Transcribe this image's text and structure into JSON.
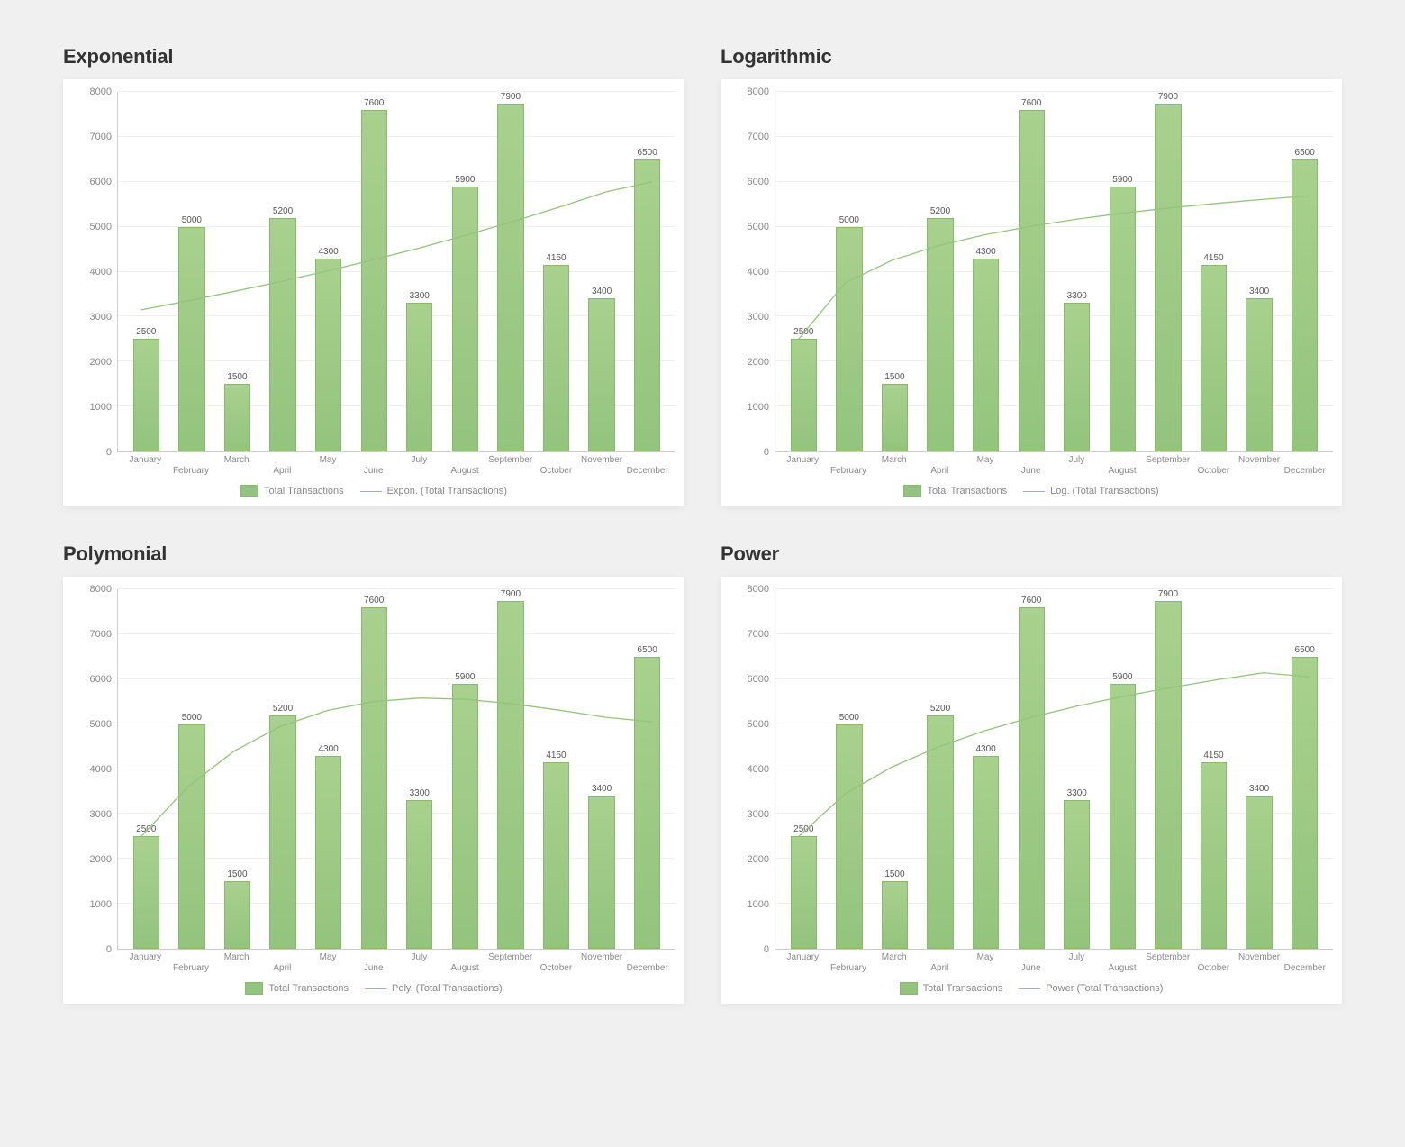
{
  "chart_data": [
    {
      "id": "exponential",
      "title": "Exponential",
      "type": "bar",
      "categories": [
        "January",
        "February",
        "March",
        "April",
        "May",
        "June",
        "July",
        "August",
        "September",
        "October",
        "November",
        "December"
      ],
      "values": [
        2500,
        5000,
        1500,
        5200,
        4300,
        7600,
        3300,
        5900,
        7900,
        4150,
        3400,
        6500
      ],
      "ylim": [
        0,
        8000
      ],
      "ytick_step": 1000,
      "legend_series": "Total Transactions",
      "legend_trend": "Expon. (Total Transactions)",
      "trendline_type": "exponential",
      "trendline_points": [
        3150,
        3350,
        3560,
        3780,
        4015,
        4265,
        4530,
        4815,
        5115,
        5435,
        5775,
        6000
      ]
    },
    {
      "id": "logarithmic",
      "title": "Logarithmic",
      "type": "bar",
      "categories": [
        "January",
        "February",
        "March",
        "April",
        "May",
        "June",
        "July",
        "August",
        "September",
        "October",
        "November",
        "December"
      ],
      "values": [
        2500,
        5000,
        1500,
        5200,
        4300,
        7600,
        3300,
        5900,
        7900,
        4150,
        3400,
        6500
      ],
      "ylim": [
        0,
        8000
      ],
      "ytick_step": 1000,
      "legend_series": "Total Transactions",
      "legend_trend": "Log. (Total Transactions)",
      "trendline_type": "logarithmic",
      "trendline_points": [
        2500,
        3750,
        4250,
        4575,
        4820,
        5010,
        5170,
        5305,
        5420,
        5520,
        5610,
        5690
      ]
    },
    {
      "id": "polymonial",
      "title": "Polymonial",
      "type": "bar",
      "categories": [
        "January",
        "February",
        "March",
        "April",
        "May",
        "June",
        "July",
        "August",
        "September",
        "October",
        "November",
        "December"
      ],
      "values": [
        2500,
        5000,
        1500,
        5200,
        4300,
        7600,
        3300,
        5900,
        7900,
        4150,
        3400,
        6500
      ],
      "ylim": [
        0,
        8000
      ],
      "ytick_step": 1000,
      "legend_series": "Total Transactions",
      "legend_trend": "Poly. (Total Transactions)",
      "trendline_type": "polynomial",
      "trendline_points": [
        2500,
        3600,
        4400,
        4950,
        5300,
        5500,
        5580,
        5550,
        5450,
        5310,
        5150,
        5050
      ]
    },
    {
      "id": "power",
      "title": "Power",
      "type": "bar",
      "categories": [
        "January",
        "February",
        "March",
        "April",
        "May",
        "June",
        "July",
        "August",
        "September",
        "October",
        "November",
        "December"
      ],
      "values": [
        2500,
        5000,
        1500,
        5200,
        4300,
        7600,
        3300,
        5900,
        7900,
        4150,
        3400,
        6500
      ],
      "ylim": [
        0,
        8000
      ],
      "ytick_step": 1000,
      "legend_series": "Total Transactions",
      "legend_trend": "Power (Total Transactions)",
      "trendline_type": "power",
      "trendline_points": [
        2500,
        3450,
        4040,
        4490,
        4850,
        5150,
        5400,
        5620,
        5810,
        5985,
        6140,
        6050
      ]
    }
  ]
}
